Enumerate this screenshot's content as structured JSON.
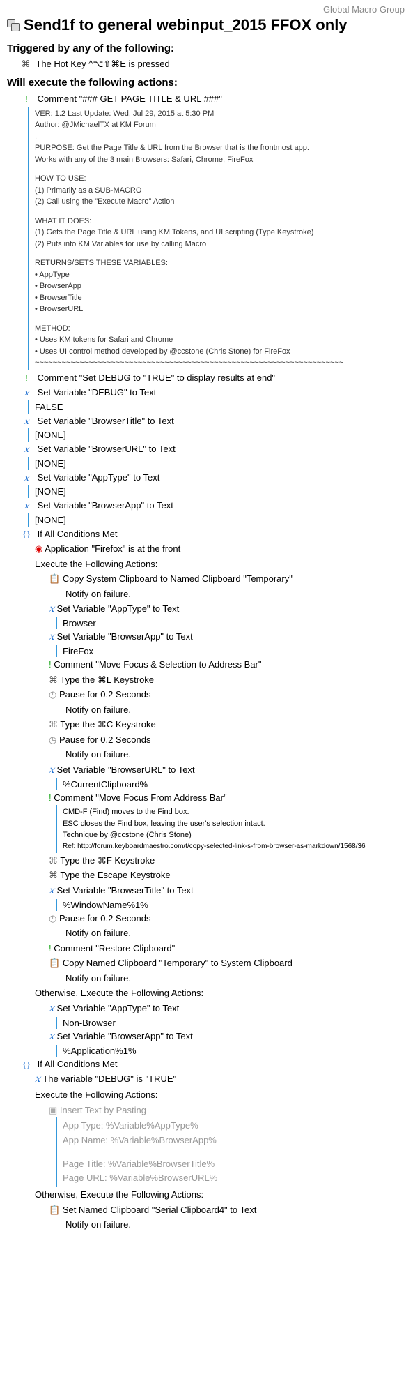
{
  "header": {
    "group": "Global Macro Group"
  },
  "title": "Send1f to general webinput_2015 FFOX only",
  "triggered_hdr": "Triggered by any of the following:",
  "trigger": "The Hot Key ^⌥⇧⌘E is pressed",
  "execute_hdr": "Will execute the following actions:",
  "c1": "Comment \"### GET PAGE TITLE & URL ###\"",
  "c1b": {
    "l1": "VER:  1.2      Last Update: Wed, Jul 29, 2015 at 5:30 PM",
    "l2": "Author:  @JMichaelTX at KM Forum",
    "l3": ".",
    "l4": "PURPOSE:  Get the Page Title & URL from the Browser that is the frontmost app.",
    "l5": "Works with any of the 3 main Browsers:  Safari, Chrome, FireFox",
    "l6": "HOW TO USE:",
    "l7": "(1) Primarily as a SUB-MACRO",
    "l8": "(2) Call using the \"Execute Macro\" Action",
    "l9": "WHAT IT DOES:",
    "l10": "(1) Gets the Page Title & URL using KM Tokens, and UI scripting (Type Keystroke)",
    "l11": "(2) Puts into KM Variables for use by calling Macro",
    "l12": "RETURNS/SETS THESE VARIABLES:",
    "l13": "• AppType",
    "l14": "• BrowserApp",
    "l15": "• BrowserTitle",
    "l16": "• BrowserURL",
    "l17": "METHOD:",
    "l18": "• Uses KM tokens for Safari and Chrome",
    "l19": "• Uses UI control method developed by @ccstone (Chris Stone) for FireFox",
    "tilde": "~~~~~~~~~~~~~~~~~~~~~~~~~~~~~~~~~~~~~~~~~~~~~~~~~~~~~~~~~~~~~~~~~~~~~"
  },
  "c2": "Comment \"Set DEBUG to \"TRUE\" to display results at end\"",
  "v1": "Set Variable \"DEBUG\" to Text",
  "v1v": "FALSE",
  "v2": "Set Variable \"BrowserTitle\" to Text",
  "v2v": "[NONE]",
  "v3": "Set Variable \"BrowserURL\" to Text",
  "v3v": "[NONE]",
  "v4": "Set Variable \"AppType\" to Text",
  "v4v": "[NONE]",
  "v5": "Set Variable \"BrowserApp\" to Text",
  "v5v": "[NONE]",
  "if1": "If All Conditions Met",
  "if1c": "Application \"Firefox\" is at the front",
  "exec1": "Execute the Following Actions:",
  "a1": "Copy System Clipboard to Named Clipboard \"Temporary\"",
  "notify": "Notify on failure.",
  "a2": "Set Variable \"AppType\" to Text",
  "a2v": "Browser",
  "a3": "Set Variable \"BrowserApp\" to Text",
  "a3v": "FireFox",
  "a4": "Comment \"Move Focus & Selection to Address Bar\"",
  "a5": "Type the ⌘L Keystroke",
  "a6": "Pause for 0.2 Seconds",
  "a7": "Type the ⌘C Keystroke",
  "a8": "Pause for 0.2 Seconds",
  "a9": "Set Variable \"BrowserURL\" to Text",
  "a9v": "%CurrentClipboard%",
  "a10": "Comment \"Move Focus From Address Bar\"",
  "a10b": {
    "l1": "CMD-F (Find) moves to the Find box.",
    "l2": "ESC closes the Find box, leaving the user's selection intact.",
    "l3": "Technique by @ccstone (Chris Stone)",
    "l4": "Ref:  http://forum.keyboardmaestro.com/t/copy-selected-link-s-from-browser-as-markdown/1568/36"
  },
  "a11": "Type the ⌘F Keystroke",
  "a12": "Type the Escape Keystroke",
  "a13": "Set Variable \"BrowserTitle\" to Text",
  "a13v": "%WindowName%1%",
  "a14": "Pause for 0.2 Seconds",
  "a15": "Comment \"Restore Clipboard\"",
  "a16": "Copy Named Clipboard \"Temporary\" to System Clipboard",
  "else1": "Otherwise, Execute the Following Actions:",
  "e1": "Set Variable \"AppType\" to Text",
  "e1v": "Non-Browser",
  "e2": "Set Variable \"BrowserApp\" to Text",
  "e2v": "%Application%1%",
  "if2": "If All Conditions Met",
  "if2c": "The variable \"DEBUG\" is \"TRUE\"",
  "exec2": "Execute the Following Actions:",
  "p1": "Insert Text by Pasting",
  "pb": {
    "l1": "App Type: %Variable%AppType%",
    "l2": "App Name: %Variable%BrowserApp%",
    "l3": "Page Title: %Variable%BrowserTitle%",
    "l4": "Page URL: %Variable%BrowserURL%"
  },
  "else2": "Otherwise, Execute the Following Actions:",
  "f1": "Set Named Clipboard \"Serial Clipboard4\" to Text",
  "glyphs": {
    "cmd": "⌘",
    "exclaim": "!",
    "x": "𝑥",
    "braces": "{}",
    "app": "◉",
    "clip": "📋",
    "key": "⌘",
    "clock": "◷",
    "paste": "▣"
  }
}
